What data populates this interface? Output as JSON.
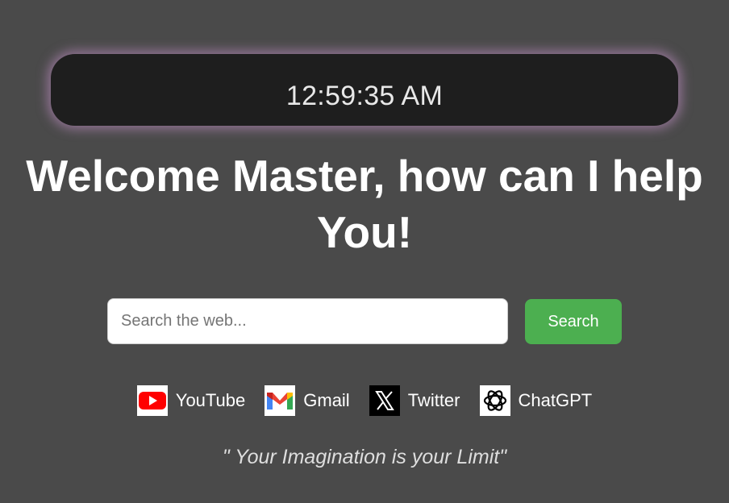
{
  "clock": {
    "time": "12:59:35 AM"
  },
  "header": {
    "title": "Welcome Master, how can I help You!"
  },
  "search": {
    "placeholder": "Search the web...",
    "value": "",
    "button_label": "Search"
  },
  "links": [
    {
      "label": "YouTube",
      "icon": "youtube-icon"
    },
    {
      "label": "Gmail",
      "icon": "gmail-icon"
    },
    {
      "label": "Twitter",
      "icon": "x-twitter-icon"
    },
    {
      "label": "ChatGPT",
      "icon": "chatgpt-icon"
    }
  ],
  "quote": "\" Your Imagination is your Limit\"",
  "colors": {
    "background": "#4a4a4a",
    "clock_bg": "#1e1e1e",
    "clock_glow": "#cd96d2",
    "search_button": "#4caf50"
  }
}
